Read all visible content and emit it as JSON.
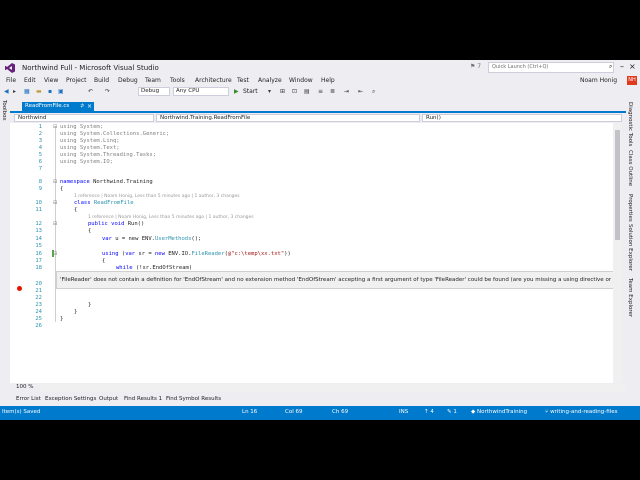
{
  "window": {
    "title": "Northwind Full - Microsoft Visual Studio",
    "quick_launch_placeholder": "Quick Launch (Ctrl+Q)",
    "filter_count": "7",
    "user": "Noam Honig",
    "avatar_initials": "NH"
  },
  "menu": [
    "File",
    "Edit",
    "View",
    "Project",
    "Build",
    "Debug",
    "Team",
    "Tools",
    "Architecture",
    "Test",
    "Analyze",
    "Window",
    "Help"
  ],
  "toolbar": {
    "config": "Debug",
    "platform": "Any CPU",
    "start_label": "Start"
  },
  "side": {
    "left_label": "Toolbox",
    "right_tabs": [
      "Diagnostic Tools",
      "Class Outline",
      "Properties",
      "Solution Explorer",
      "Team Explorer"
    ]
  },
  "doc_tab": {
    "label": "ReadFromFile.cs",
    "pin": "⊅",
    "close": "×"
  },
  "nav": {
    "project": "Northwind",
    "class": "Northwind.Training.ReadFromFile",
    "member": "Run()"
  },
  "code": {
    "line_numbers": [
      "1",
      "2",
      "3",
      "4",
      "5",
      "6",
      "7",
      "8",
      "9",
      "10",
      "11",
      "12",
      "13",
      "14",
      "15",
      "16",
      "17",
      "18",
      "",
      "20",
      "21",
      "22",
      "23",
      "24",
      "25",
      "26"
    ],
    "lens1": "1 reference | Noam Honig, Less than 5 minutes ago | 1 author, 3 changes",
    "lens2": "1 reference | Noam Honig, Less than 5 minutes ago | 1 author, 3 changes",
    "using1": "using System;",
    "using2": "using System.Collections.Generic;",
    "using3": "using System.Linq;",
    "using4": "using System.Text;",
    "using5": "using System.Threading.Tasks;",
    "using6": "using System.IO;",
    "ns_kw": "namespace",
    "ns_name": " Northwind.Training",
    "brace_open": "{",
    "class_kw": "class",
    "class_name": " ReadFromFile",
    "brace_open2": "{",
    "method_kw1": "public",
    "method_kw2": " void",
    "method_name": " Run()",
    "brace_open3": "{",
    "l14_kw": "var",
    "l14_rest": " u = new ENV.",
    "l14_type": "UserMethods",
    "l14_end": "();",
    "l16_kw": "using",
    "l16_a": " (",
    "l16_kw2": "var",
    "l16_b": " sr = ",
    "l16_kw3": "new",
    "l16_c": " ENV.IO.",
    "l16_type": "FileReader",
    "l16_d": "(",
    "l16_str": "@\"c:\\temp\\xx.txt\"",
    "l16_e": "))",
    "brace_open4": "{",
    "l18_kw": "while",
    "l18_rest": " (!sr.EndOfStream)",
    "brace_close_a": "}",
    "brace_close_b": "}",
    "brace_close_c": "}",
    "outline_minus": "⊟"
  },
  "tooltip": "'FileReader' does not contain a definition for 'EndOfStream' and no extension method 'EndOfStream' accepting a first argument of type 'FileReader' could be found (are you missing a using directive or an assembly",
  "zoom": "100 %",
  "bottom_tabs": [
    "Error List",
    "Exception Settings",
    "Output",
    "Find Results 1",
    "Find Symbol Results"
  ],
  "status": {
    "left": "Item(s) Saved",
    "ln": "Ln 16",
    "col": "Col 69",
    "ch": "Ch 69",
    "ins": "INS",
    "up_count": "4",
    "pencil_count": "1",
    "project": "NorthwindTraining",
    "branch": "writing-and-reading-files"
  },
  "colors": {
    "accent": "#007acc",
    "chrome": "#eeeef2",
    "keyword": "#0000ff",
    "type": "#2b91af",
    "string": "#a31515"
  }
}
